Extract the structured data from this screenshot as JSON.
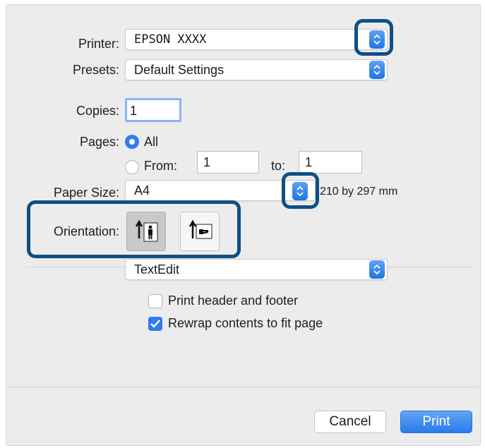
{
  "printer": {
    "label": "Printer:",
    "value": "EPSON XXXX"
  },
  "presets": {
    "label": "Presets:",
    "value": "Default Settings"
  },
  "copies": {
    "label": "Copies:",
    "value": "1"
  },
  "pages": {
    "label": "Pages:",
    "all_label": "All",
    "from_label": "From:",
    "from_value": "1",
    "to_label": "to:",
    "to_value": "1",
    "selected": "All"
  },
  "paper_size": {
    "label": "Paper Size:",
    "value": "A4",
    "dimensions": "210 by 297 mm"
  },
  "orientation": {
    "label": "Orientation:",
    "selected": "portrait"
  },
  "app_section": {
    "value": "TextEdit"
  },
  "options": [
    {
      "label": "Print header and footer",
      "checked": false
    },
    {
      "label": "Rewrap contents to fit page",
      "checked": true
    }
  ],
  "buttons": {
    "cancel": "Cancel",
    "print": "Print"
  },
  "colors": {
    "accent": "#2f7bf0",
    "callout": "#0f4f84"
  }
}
